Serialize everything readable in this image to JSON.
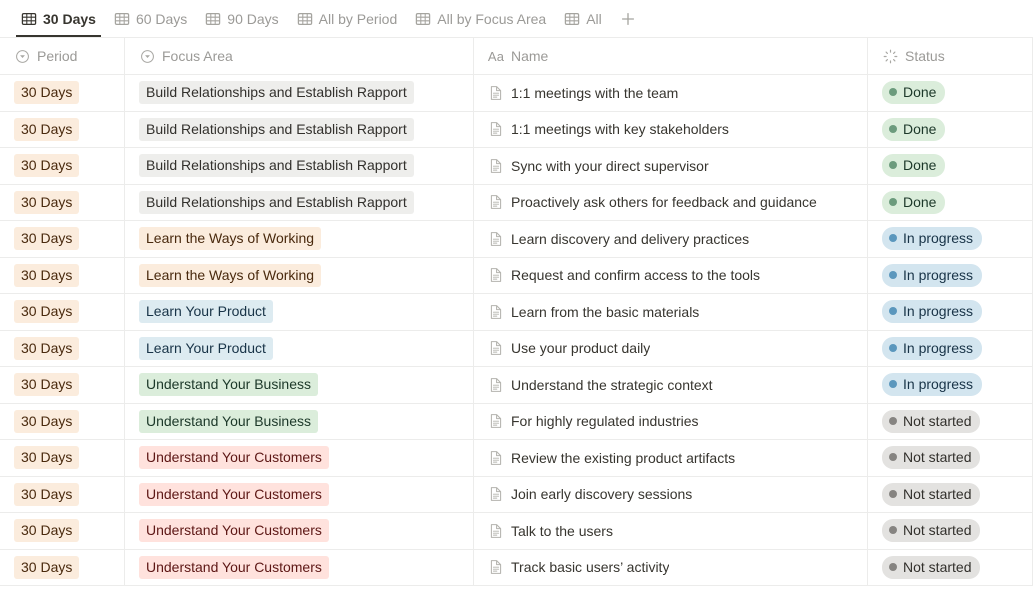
{
  "view_tabs": [
    {
      "label": "30 Days",
      "icon": "table-icon",
      "active": true
    },
    {
      "label": "60 Days",
      "icon": "table-icon",
      "active": false
    },
    {
      "label": "90 Days",
      "icon": "table-icon",
      "active": false
    },
    {
      "label": "All by Period",
      "icon": "table-icon",
      "active": false
    },
    {
      "label": "All by Focus Area",
      "icon": "table-icon",
      "active": false
    },
    {
      "label": "All",
      "icon": "table-icon",
      "active": false
    }
  ],
  "add_view_label": "+",
  "add_view_icon": "plus-icon",
  "columns": [
    {
      "label": "Period",
      "icon": "select-property-icon",
      "key": "period"
    },
    {
      "label": "Focus Area",
      "icon": "select-property-icon",
      "key": "focus"
    },
    {
      "label": "Name",
      "icon": "title-property-icon",
      "key": "name"
    },
    {
      "label": "Status",
      "icon": "status-property-icon",
      "key": "status"
    }
  ],
  "colors": {
    "tag_orange_bg": "#fbecdd",
    "tag_gray_bg": "#eeeeec",
    "tag_blue_bg": "#ddebf1",
    "tag_green_bg": "#dbeddb",
    "tag_red_bg": "#ffe2dd",
    "status_done_bg": "#dbeddb",
    "status_done_dot": "#6c9b7d",
    "status_inprogress_bg": "#d3e5ef",
    "status_inprogress_dot": "#5b97bd",
    "status_notstarted_bg": "#e3e2e0",
    "status_notstarted_dot": "#868481",
    "active_tab_underline": "#37352f",
    "text_primary": "#37352f",
    "text_muted": "#9b9a97",
    "border": "#ececeb"
  },
  "rows": [
    {
      "period": "30 Days",
      "period_color": "orange",
      "focus": "Build Relationships and Establish Rapport",
      "focus_color": "gray",
      "name": "1:1 meetings with the team",
      "status": "Done",
      "status_class": "done"
    },
    {
      "period": "30 Days",
      "period_color": "orange",
      "focus": "Build Relationships and Establish Rapport",
      "focus_color": "gray",
      "name": "1:1 meetings with key stakeholders",
      "status": "Done",
      "status_class": "done"
    },
    {
      "period": "30 Days",
      "period_color": "orange",
      "focus": "Build Relationships and Establish Rapport",
      "focus_color": "gray",
      "name": "Sync with your direct supervisor",
      "status": "Done",
      "status_class": "done"
    },
    {
      "period": "30 Days",
      "period_color": "orange",
      "focus": "Build Relationships and Establish Rapport",
      "focus_color": "gray",
      "name": "Proactively ask others for feedback and guidance",
      "status": "Done",
      "status_class": "done"
    },
    {
      "period": "30 Days",
      "period_color": "orange",
      "focus": "Learn the Ways of Working",
      "focus_color": "orange",
      "name": "Learn discovery and delivery practices",
      "status": "In progress",
      "status_class": "prog"
    },
    {
      "period": "30 Days",
      "period_color": "orange",
      "focus": "Learn the Ways of Working",
      "focus_color": "orange",
      "name": "Request and confirm access to the tools",
      "status": "In progress",
      "status_class": "prog"
    },
    {
      "period": "30 Days",
      "period_color": "orange",
      "focus": "Learn Your Product",
      "focus_color": "blue",
      "name": "Learn from the basic materials",
      "status": "In progress",
      "status_class": "prog"
    },
    {
      "period": "30 Days",
      "period_color": "orange",
      "focus": "Learn Your Product",
      "focus_color": "blue",
      "name": "Use your product daily",
      "status": "In progress",
      "status_class": "prog"
    },
    {
      "period": "30 Days",
      "period_color": "orange",
      "focus": "Understand Your Business",
      "focus_color": "green",
      "name": "Understand the strategic context",
      "status": "In progress",
      "status_class": "prog"
    },
    {
      "period": "30 Days",
      "period_color": "orange",
      "focus": "Understand Your Business",
      "focus_color": "green",
      "name": "For highly regulated industries",
      "status": "Not started",
      "status_class": "none"
    },
    {
      "period": "30 Days",
      "period_color": "orange",
      "focus": "Understand Your Customers",
      "focus_color": "red",
      "name": "Review the existing product artifacts",
      "status": "Not started",
      "status_class": "none"
    },
    {
      "period": "30 Days",
      "period_color": "orange",
      "focus": "Understand Your Customers",
      "focus_color": "red",
      "name": "Join early discovery sessions",
      "status": "Not started",
      "status_class": "none"
    },
    {
      "period": "30 Days",
      "period_color": "orange",
      "focus": "Understand Your Customers",
      "focus_color": "red",
      "name": "Talk to the users",
      "status": "Not started",
      "status_class": "none"
    },
    {
      "period": "30 Days",
      "period_color": "orange",
      "focus": "Understand Your Customers",
      "focus_color": "red",
      "name": "Track basic users’ activity",
      "status": "Not started",
      "status_class": "none"
    }
  ]
}
